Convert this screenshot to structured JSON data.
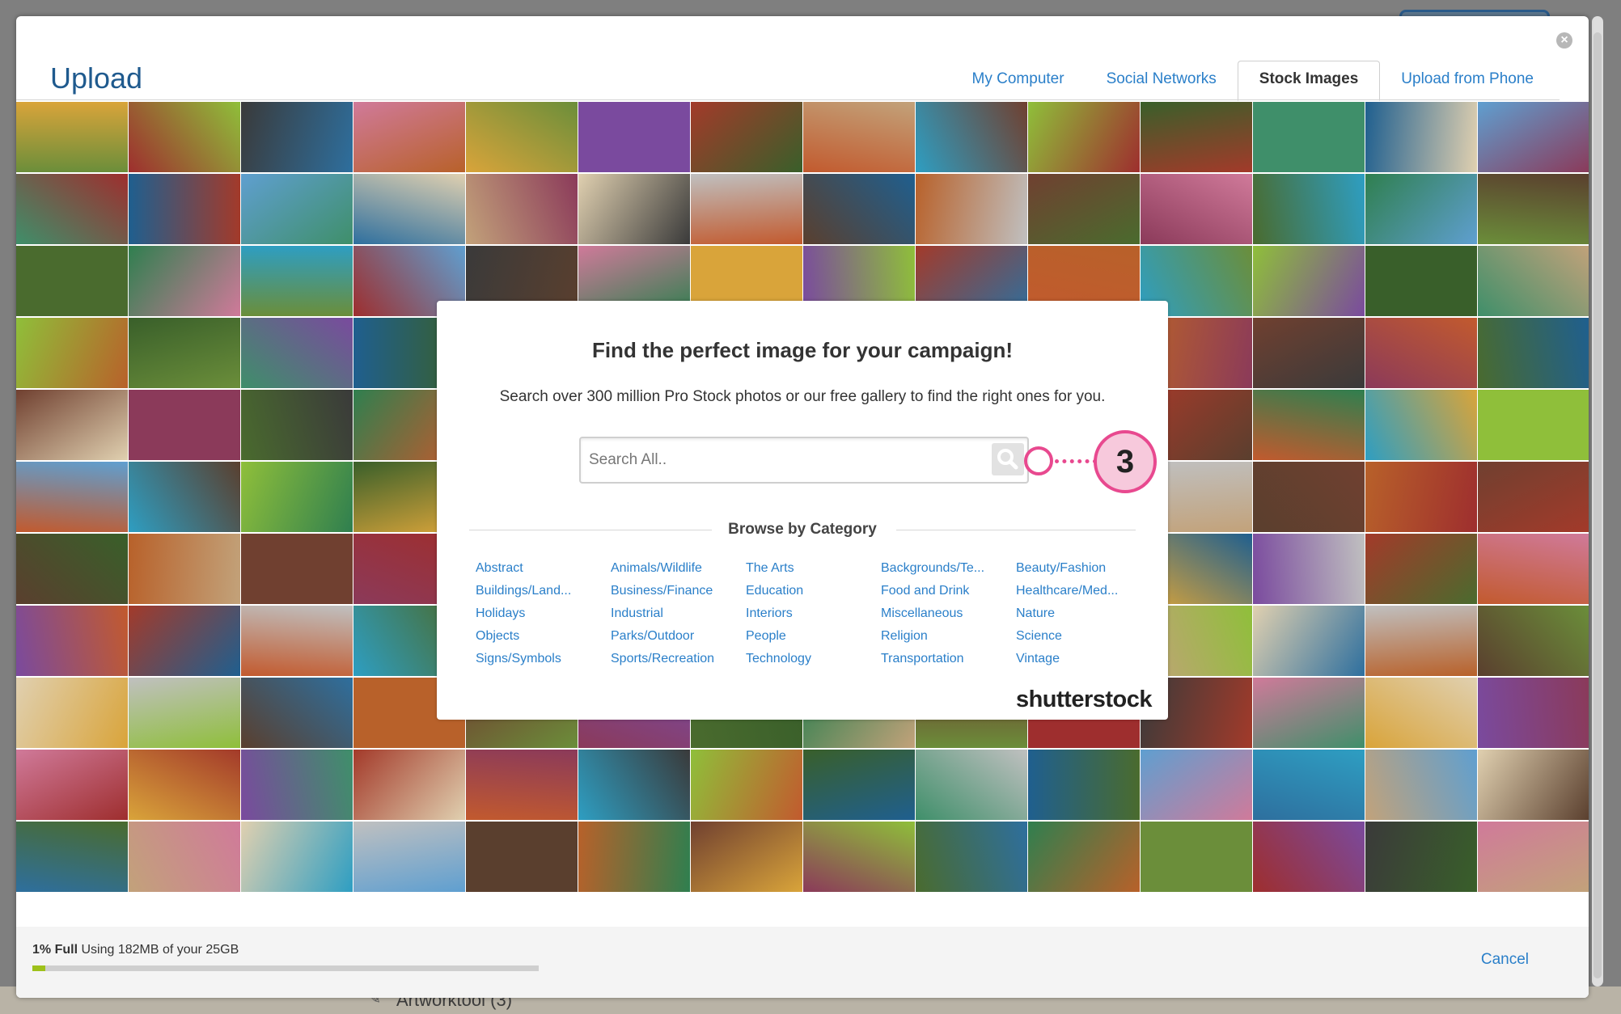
{
  "backdrop": {
    "list_item": "Artworktool (3)"
  },
  "header": {
    "title": "Upload",
    "tabs": [
      {
        "label": "My Computer",
        "active": false
      },
      {
        "label": "Social Networks",
        "active": false
      },
      {
        "label": "Stock Images",
        "active": true
      },
      {
        "label": "Upload from Phone",
        "active": false
      }
    ]
  },
  "search_card": {
    "heading": "Find the perfect image for your campaign!",
    "subtitle": "Search over 300 million Pro Stock photos or our free gallery to find the right ones for you.",
    "search_placeholder": "Search All..",
    "step_number": "3",
    "browse_title": "Browse by Category",
    "categories": [
      "Abstract",
      "Animals/Wildlife",
      "The Arts",
      "Backgrounds/Te...",
      "Beauty/Fashion",
      "Buildings/Land...",
      "Business/Finance",
      "Education",
      "Food and Drink",
      "Healthcare/Med...",
      "Holidays",
      "Industrial",
      "Interiors",
      "Miscellaneous",
      "Nature",
      "Objects",
      "Parks/Outdoor",
      "People",
      "Religion",
      "Science",
      "Signs/Symbols",
      "Sports/Recreation",
      "Technology",
      "Transportation",
      "Vintage"
    ],
    "brand": "shutterstock"
  },
  "footer": {
    "usage_percent": "1% Full",
    "usage_text": "Using 182MB of your 25GB",
    "usage_fraction": 0.01,
    "cancel_label": "Cancel"
  },
  "colors": {
    "link": "#2a7fc9",
    "title": "#1f5a8e",
    "marker": "#e8498f",
    "progress": "#9ec11a"
  },
  "mosaic_palette": [
    "#6b8e3a",
    "#c25a2e",
    "#2e6f9e",
    "#8b3a5a",
    "#d9a43a",
    "#3f8f6a",
    "#5a3f2e",
    "#9e2e2e",
    "#2e9ec2",
    "#c2a27a",
    "#4a6b2e",
    "#7a4a9e",
    "#1f5f8f",
    "#b8612a",
    "#3a3a3a",
    "#8fbf3a",
    "#e0d0b0",
    "#2f7f4f",
    "#a33a2a",
    "#5f9fd0",
    "#704030",
    "#d07a9a",
    "#395f2a",
    "#c0c0c0"
  ]
}
